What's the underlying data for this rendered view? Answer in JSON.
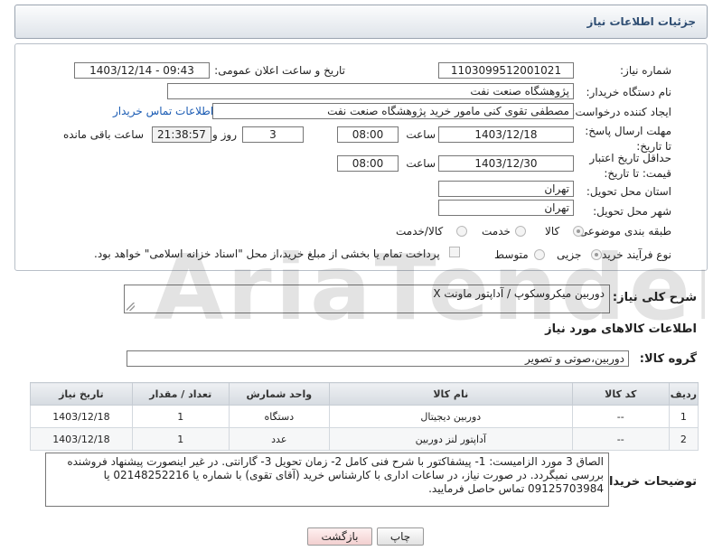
{
  "header": {
    "title": "جزئیات اطلاعات نیاز"
  },
  "form": {
    "need_number_label": "شماره نیاز:",
    "need_number": "1103099512001021",
    "announce_label": "تاریخ و ساعت اعلان عمومی:",
    "announce_value": "1403/12/14 - 09:43",
    "buyer_label": "نام دستگاه خریدار:",
    "buyer_value": "پژوهشگاه صنعت نفت",
    "creator_label": "ایجاد کننده درخواست:",
    "creator_value": "مصطفی تقوی کنی مامور خرید پژوهشگاه صنعت نفت",
    "contact_link": "اطلاعات تماس خریدار",
    "deadline_label": "مهلت ارسال پاسخ: تا تاریخ:",
    "deadline_date": "1403/12/18",
    "time_label": "ساعت",
    "deadline_time": "08:00",
    "days_value": "3",
    "days_label": "روز و",
    "remaining_time": "21:38:57",
    "remaining_label": "ساعت باقی مانده",
    "validity_label": "حداقل تاریخ اعتبار قیمت: تا تاریخ:",
    "validity_date": "1403/12/30",
    "validity_time": "08:00",
    "province_label": "استان محل تحویل:",
    "province_value": "تهران",
    "city_label": "شهر محل تحویل:",
    "city_value": "تهران",
    "category_label": "طبقه بندی موضوعی:",
    "category_options": [
      "کالا",
      "خدمت",
      "کالا/خدمت"
    ],
    "category_selected": "کالا",
    "process_label": "نوع فرآیند خرید :",
    "process_options": [
      "جزیی",
      "متوسط"
    ],
    "process_selected": "جزیی",
    "payment_note": "پرداخت تمام یا بخشی از مبلغ خرید،از محل \"اسناد خزانه اسلامی\" خواهد بود."
  },
  "summary": {
    "label": "شرح کلی نیاز:",
    "value": "دوربین میکروسکوپ / آداپتور ماونت X"
  },
  "goods": {
    "section_title": "اطلاعات کالاهای مورد نیاز",
    "group_label": "گروه کالا:",
    "group_value": "دوربین،صوتی و تصویر",
    "columns": [
      "ردیف",
      "کد کالا",
      "نام کالا",
      "واحد شمارش",
      "تعداد / مقدار",
      "تاریخ نیاز"
    ],
    "rows": [
      {
        "row": "1",
        "code": "--",
        "name": "دوربین دیجیتال",
        "unit": "دستگاه",
        "qty": "1",
        "date": "1403/12/18"
      },
      {
        "row": "2",
        "code": "--",
        "name": "آداپتور لنز دوربین",
        "unit": "عدد",
        "qty": "1",
        "date": "1403/12/18"
      }
    ]
  },
  "buyer_notes": {
    "label": "توضیحات خریدار:",
    "text": "الصاق 3 مورد الزامیست: 1- پیشفاکتور با شرح فنی کامل 2- زمان تحویل 3- گارانتی. در غیر اینصورت پیشنهاد فروشنده بررسی نمیگردد. در صورت نیاز، در ساعات اداری با کارشناس خرید (آقای تقوی) با شماره یا 02148252216 یا 09125703984 تماس حاصل فرمایید."
  },
  "buttons": {
    "print": "چاپ",
    "back": "بازگشت"
  },
  "watermark": "AriaTender.net"
}
